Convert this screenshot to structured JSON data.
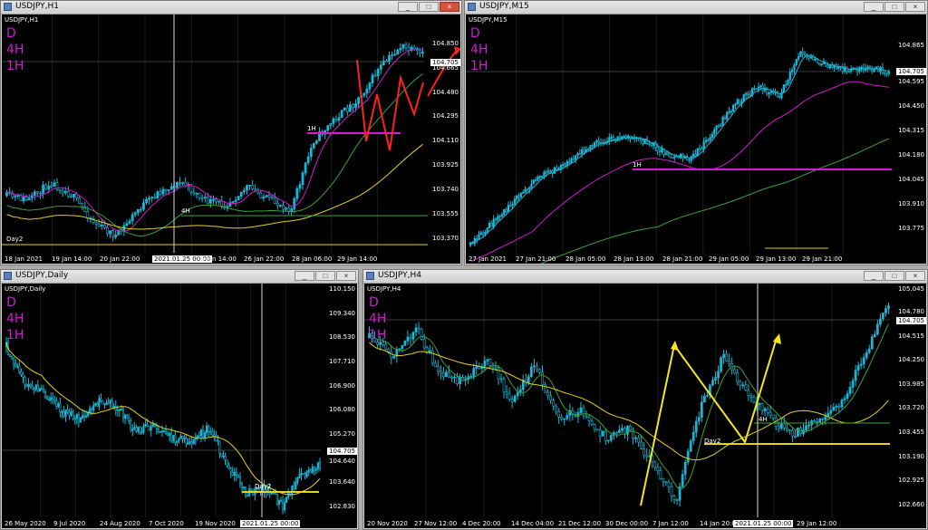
{
  "windows": [
    {
      "title": "USDJPY,H1",
      "symbol_label": "USDJPY,H1",
      "timeframes": [
        "D",
        "4H",
        "1H"
      ],
      "price_labels": [
        "104.850",
        "104.665",
        "104.480",
        "104.295",
        "104.110",
        "103.925",
        "103.740",
        "103.555",
        "103.370"
      ],
      "current_price": "104.705",
      "time_labels": [
        "18 Jan 2021",
        "19 Jan 14:00",
        "20 Jan 22:00",
        "2021.01.25 00:00",
        "5 Jan 14:00",
        "26 Jan 22:00",
        "28 Jan 06:00",
        "29 Jan 14:00"
      ],
      "annotations": [
        "1H",
        "4H",
        "Day2"
      ]
    },
    {
      "title": "USDJPY,M15",
      "symbol_label": "USDJPY,M15",
      "timeframes": [
        "D",
        "4H",
        "1H"
      ],
      "price_labels": [
        "104.865",
        "104.705",
        "104.595",
        "104.450",
        "104.315",
        "104.180",
        "104.045",
        "103.910",
        "103.775"
      ],
      "current_price": "104.705",
      "time_labels": [
        "27 Jan 2021",
        "27 Jan 21:00",
        "28 Jan 05:00",
        "28 Jan 13:00",
        "28 Jan 21:00",
        "29 Jan 05:00",
        "29 Jan 13:00",
        "29 Jan 21:00"
      ],
      "annotations": [
        "1H"
      ]
    },
    {
      "title": "USDJPY,Daily",
      "symbol_label": "USDJPY,Daily",
      "timeframes": [
        "D",
        "4H",
        "1H"
      ],
      "price_labels": [
        "110.150",
        "109.340",
        "108.530",
        "107.710",
        "106.900",
        "106.080",
        "105.270",
        "104.640",
        "103.640",
        "102.830"
      ],
      "current_price": "104.705",
      "time_labels": [
        "26 May 2020",
        "9 Jul 2020",
        "24 Aug 2020",
        "7 Oct 2020",
        "19 Nov 2020",
        "2021.01.25 00:00"
      ],
      "annotations": [
        "Day2"
      ]
    },
    {
      "title": "USDJPY,H4",
      "symbol_label": "USDJPY,H4",
      "timeframes": [
        "D",
        "4H",
        "1H"
      ],
      "price_labels": [
        "105.045",
        "104.780",
        "104.515",
        "104.250",
        "103.985",
        "103.720",
        "103.455",
        "103.190",
        "102.925",
        "102.660"
      ],
      "current_price": "104.705",
      "time_labels": [
        "20 Nov 2020",
        "27 Nov 12:00",
        "4 Dec 20:00",
        "14 Dec 04:00",
        "21 Dec 12:00",
        "30 Dec 00:00",
        "7 Jan 12:00",
        "14 Jan 20:00",
        "2021.01.25 00:00",
        "29 Jan 12:00"
      ],
      "annotations": [
        "4H",
        "Day2"
      ]
    }
  ],
  "colors": {
    "timeframe_text": "#d11ad1",
    "candles": "#18b8d8",
    "ma_magenta": "#d11ad1",
    "ma_green": "#3aa33a",
    "ma_yellow": "#e6d21a",
    "projection": "#ff2020",
    "wave": "#f5e61a"
  },
  "window_buttons": [
    "minimize",
    "maximize",
    "close"
  ]
}
